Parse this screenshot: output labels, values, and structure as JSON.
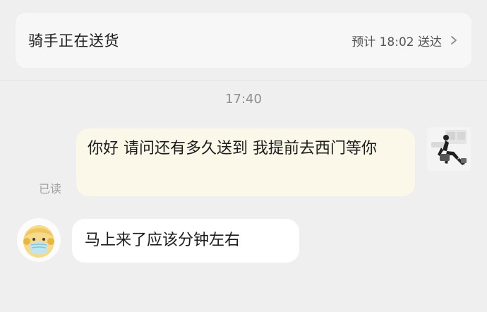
{
  "status_bar": {
    "title": "骑手正在送货",
    "eta": "预计 18:02 送达",
    "chevron_icon": "chevron-right-icon"
  },
  "chat": {
    "timestamp": "17:40",
    "messages": [
      {
        "sender": "user",
        "text": "你好 请问还有多久送到 我提前去西门等你",
        "read_status": "已读",
        "avatar_icon": "user-avatar"
      },
      {
        "sender": "rider",
        "text": "马上来了应该分钟左右",
        "avatar_icon": "rider-avatar"
      }
    ]
  },
  "colors": {
    "background": "#efefef",
    "card": "#f7f7f7",
    "user_bubble": "#fbf7e9",
    "rider_bubble": "#ffffff",
    "muted_text": "#8f8f8f",
    "rider_avatar_face": "#f7d98b",
    "rider_avatar_mask": "#bfe6f0"
  }
}
